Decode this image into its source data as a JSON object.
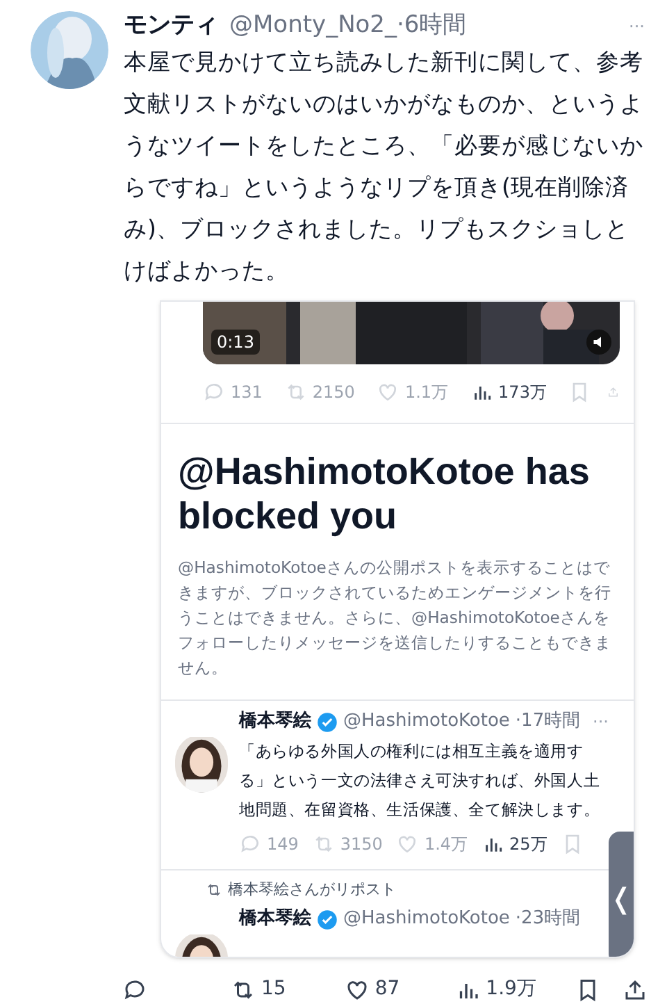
{
  "post": {
    "name": "モンティ",
    "handle": "@Monty_No2_",
    "time": "·6時間",
    "more": "···",
    "text": "本屋で見かけて立ち読みした新刊に関して、参考文献リストがないのはいかがなものか、というようなツイートをしたところ、「必要が感じないからですね」というようなリプを頂き(現在削除済み)、ブロックされました。リプもスクショしとけばよかった。"
  },
  "screenshot": {
    "video": {
      "kind": "picture",
      "duration": "0:13"
    },
    "video_actions": [
      "131",
      "2150",
      "1.1万",
      "173万"
    ],
    "blocked": {
      "title": "@HashimotoKotoe has blocked you",
      "body": "@HashimotoKotoeさんの公開ポストを表示することはできますが、ブロックされているためエンゲージメントを行うことはできません。さらに、@HashimotoKotoeさんをフォローしたりメッセージを送信したりすることもできません。"
    },
    "tweets": [
      {
        "name": "橋本琴絵",
        "verified": true,
        "handle": "@HashimotoKotoe",
        "time": "·17時間",
        "more": "···",
        "text": "「あらゆる外国人の権利には相互主義を適用する」という一文の法律さえ可決すれば、外国人土地問題、在留資格、生活保護、全て解決します。",
        "actions": [
          "149",
          "3150",
          "1.4万",
          "25万"
        ]
      },
      {
        "repost_note": "橋本琴絵さんがリポスト",
        "name": "橋本琴絵",
        "verified": true,
        "handle": "@HashimotoKotoe",
        "time": "·23時間"
      }
    ],
    "side_handle": "❬"
  },
  "actions": {
    "retweets": "15",
    "likes": "87",
    "views": "1.9万"
  }
}
